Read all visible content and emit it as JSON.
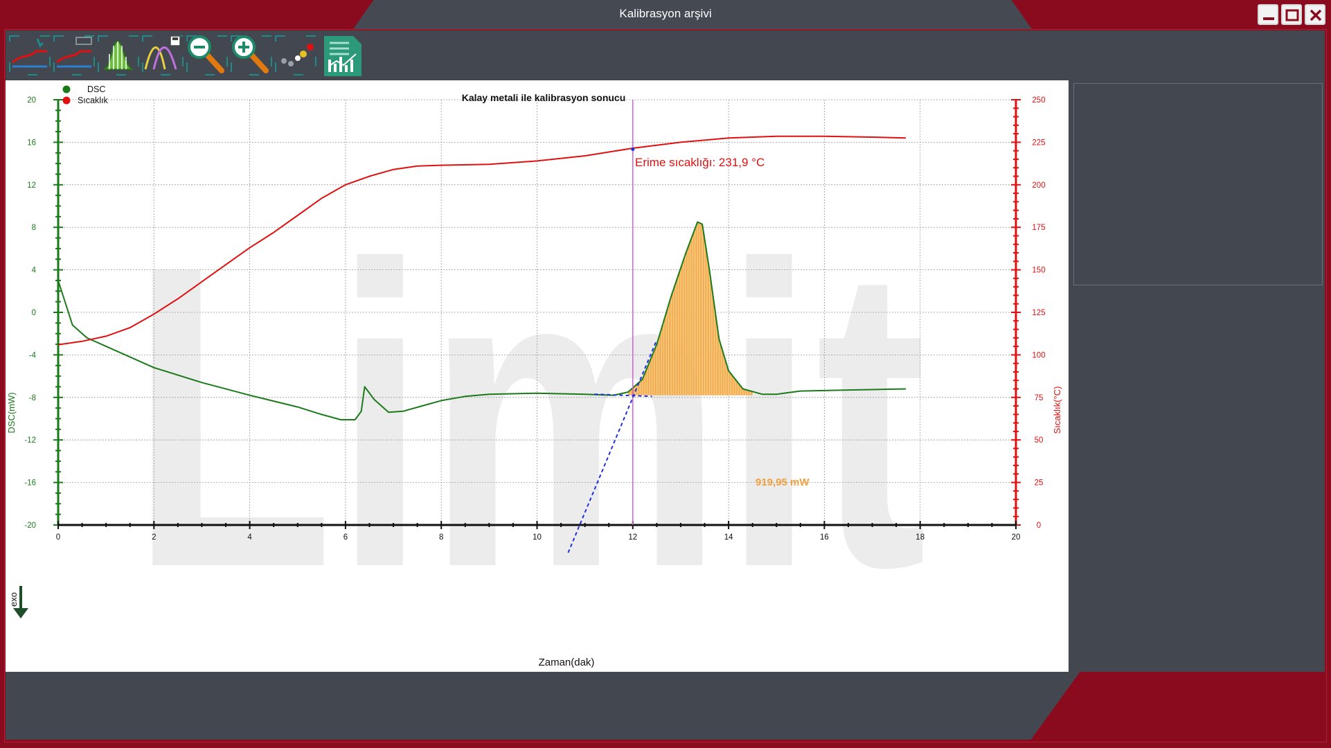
{
  "window": {
    "title": "Kalibrasyon arşivi"
  },
  "toolbar": {
    "tools": [
      {
        "name": "curve-select-tool"
      },
      {
        "name": "curve-auto-tool"
      },
      {
        "name": "peak-area-tool"
      },
      {
        "name": "curve-save-tool"
      },
      {
        "name": "zoom-out-tool"
      },
      {
        "name": "zoom-in-tool"
      },
      {
        "name": "points-tool"
      },
      {
        "name": "report-tool"
      }
    ]
  },
  "chart": {
    "title": "Kalay metali ile kalibrasyon sonucu",
    "legend": [
      {
        "label": "DSC",
        "color": "#1a7a1a"
      },
      {
        "label": "Sıcaklık",
        "color": "#e01010"
      }
    ],
    "xlabel": "Zaman(dak)",
    "ylabel_left": "DSC(mW)",
    "ylabel_right": "Sıcaklık(°C)",
    "exo_label": "exo",
    "melting_label": "Erime sıcaklığı: 231,9 °C",
    "area_label": "919,95 mW",
    "watermark": "Limit"
  },
  "chart_data": {
    "type": "line",
    "xlim": [
      0,
      20
    ],
    "ylim_left": [
      -20,
      20
    ],
    "ylim_right": [
      0,
      250
    ],
    "x_ticks": [
      "0",
      "2",
      "4",
      "6",
      "8",
      "10",
      "12",
      "14",
      "16",
      "18",
      "20"
    ],
    "y_ticks_left": [
      "20",
      "16",
      "12",
      "8",
      "4",
      "0",
      "-4",
      "-8",
      "-12",
      "-16",
      "-20"
    ],
    "y_ticks_right": [
      "250",
      "225",
      "200",
      "175",
      "150",
      "125",
      "100",
      "75",
      "50",
      "25",
      "0"
    ],
    "grid": true,
    "legend_position": "top-left",
    "series": [
      {
        "name": "DSC",
        "axis": "left",
        "color": "#1a7a1a",
        "points": [
          [
            0,
            3
          ],
          [
            0.3,
            -1.2
          ],
          [
            0.6,
            -2.4
          ],
          [
            1,
            -3.2
          ],
          [
            2,
            -5.2
          ],
          [
            3,
            -6.6
          ],
          [
            4,
            -7.8
          ],
          [
            5,
            -8.9
          ],
          [
            5.5,
            -9.6
          ],
          [
            5.9,
            -10.1
          ],
          [
            6.2,
            -10.1
          ],
          [
            6.33,
            -9.3
          ],
          [
            6.4,
            -7.0
          ],
          [
            6.6,
            -8.2
          ],
          [
            6.9,
            -9.4
          ],
          [
            7.2,
            -9.3
          ],
          [
            7.6,
            -8.8
          ],
          [
            8,
            -8.3
          ],
          [
            8.5,
            -7.9
          ],
          [
            9,
            -7.7
          ],
          [
            10,
            -7.6
          ],
          [
            11,
            -7.7
          ],
          [
            11.6,
            -7.8
          ],
          [
            11.9,
            -7.5
          ],
          [
            12.2,
            -6.3
          ],
          [
            12.5,
            -3.0
          ],
          [
            12.8,
            1.5
          ],
          [
            13.1,
            5.5
          ],
          [
            13.35,
            8.5
          ],
          [
            13.45,
            8.3
          ],
          [
            13.6,
            4.0
          ],
          [
            13.8,
            -2.5
          ],
          [
            14,
            -5.5
          ],
          [
            14.3,
            -7.2
          ],
          [
            14.7,
            -7.7
          ],
          [
            15,
            -7.7
          ],
          [
            15.5,
            -7.4
          ],
          [
            16.5,
            -7.3
          ],
          [
            17.7,
            -7.2
          ]
        ]
      },
      {
        "name": "Sıcaklık",
        "axis": "right",
        "color": "#e01010",
        "points": [
          [
            0,
            106
          ],
          [
            0.5,
            108
          ],
          [
            1,
            111
          ],
          [
            1.5,
            116
          ],
          [
            2,
            124
          ],
          [
            2.5,
            133
          ],
          [
            3,
            143
          ],
          [
            3.5,
            153
          ],
          [
            4,
            163
          ],
          [
            4.5,
            172
          ],
          [
            5,
            182
          ],
          [
            5.5,
            192
          ],
          [
            6,
            200
          ],
          [
            6.5,
            205
          ],
          [
            7,
            209
          ],
          [
            7.5,
            211
          ],
          [
            8,
            211.5
          ],
          [
            9,
            212
          ],
          [
            10,
            214
          ],
          [
            11,
            217
          ],
          [
            12,
            221.5
          ],
          [
            13,
            225
          ],
          [
            14,
            227.5
          ],
          [
            15,
            228.5
          ],
          [
            16,
            228.5
          ],
          [
            17,
            228
          ],
          [
            17.7,
            227.5
          ]
        ]
      }
    ],
    "markers": {
      "melting_time": 12,
      "melting_temperature": 231.9,
      "peak_start": 11.9,
      "peak_end": 14.5,
      "peak_area_mW": 919.95
    }
  }
}
